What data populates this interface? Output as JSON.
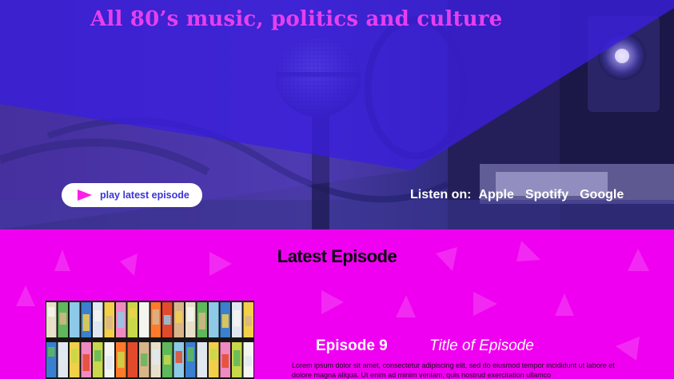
{
  "hero": {
    "tagline": "All 80’s music, politics and culture",
    "play_button_label": "play latest episode",
    "listen_label": "Listen on:",
    "platforms": [
      "Apple",
      "Spotify",
      "Google"
    ]
  },
  "latest": {
    "heading": "Latest Episode",
    "episode_number": "Episode 9",
    "episode_title": "Title of Episode",
    "description": "Lorem ipsum dolor sit amet, consectetur adipiscing elit, sed do eiusmod tempor incididunt ut labore et dolore magna aliqua. Ut enim ad minim veniam, quis nostrud exercitation ullamco"
  },
  "colors": {
    "accent_magenta": "#f000f0",
    "hero_overlay": "#3b1fe0",
    "tagline": "#e63ff0",
    "play_icon": "#ff1ee6",
    "button_text": "#3a34d8"
  },
  "icons": {
    "play": "play-icon",
    "microphone": "microphone-image",
    "cassettes": "cassette-tapes-image"
  }
}
